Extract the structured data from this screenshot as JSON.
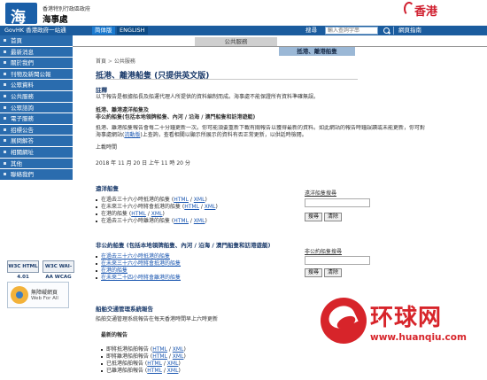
{
  "header": {
    "dept_small": "香港特別行政區政府",
    "dept_big": "海事處",
    "brand": "香港",
    "logo_glyph": "海"
  },
  "navbar": {
    "gov_link": "GovHK 香港政府一站通",
    "lang_1": "简体版",
    "lang_2": "ENGLISH",
    "search_label": "搜尋",
    "search_placeholder": "輸入查詢字串",
    "map_link": "網頁指南"
  },
  "sidebar": {
    "items": [
      "首頁",
      "最新消息",
      "關於我們",
      "刊物及新聞公報",
      "公眾資料",
      "公共服務",
      "公眾諮詢",
      "電子服務",
      "招標公告",
      "展問解答",
      "相關網址",
      "其他",
      "聯絡我們"
    ],
    "badge_w3c": "W3C HTML 4.01",
    "badge_wai": "W3C WAI-AA WCAG 2.0",
    "badge_web_1": "無障礙網頁",
    "badge_web_2": "Web For All"
  },
  "tabs": {
    "public": "公共服務",
    "sub": "抵港、離港船隻"
  },
  "breadcrumb": {
    "home": "首頁",
    "sep": " > ",
    "current": "公共服務"
  },
  "page": {
    "title": "抵港、離港船隻 (只提供英文版)",
    "notes_heading": "註釋",
    "notes_line": "以下報告是根據船長及船運代理人所提供的資料編制而成。海事處不能保證所有資料準確無誤。",
    "sub_heading_1": "抵港、離港遠洋船隻及",
    "sub_heading_2": "非公約船隻(包括本地領牌船隻、內河 / 沿海 / 澳門船隻和訪港遊艇)",
    "desc_1": "抵港、離港船隻報告會每二十分鐘更新一次。你可能須要重新下載有關報告以獲得最新的資料。如此網站的報告時鐘誤讀或未能更新，你可對",
    "desc_2_pre": "海事處網站",
    "desc_2_link": "流動版",
    "desc_2_post": "上查詢，查看相關以顯示所展示的資料有否正常更新，以供話時檢閱。",
    "update_label": "上載時間",
    "update_time": "2018 年 11 月 20 日 上午 11 時 20 分"
  },
  "ocean": {
    "heading": "遠洋船隻",
    "items": [
      {
        "text": "在過去三十六小時抵港的船隻 (",
        "html": "HTML",
        "slash": " / ",
        "xml": "XML",
        "end": ")"
      },
      {
        "text": "在未來三十六小時將會抵港的船隻 (",
        "html": "HTML",
        "slash": " / ",
        "xml": "XML",
        "end": ")"
      },
      {
        "text": "在港的船隻 (",
        "html": "HTML",
        "slash": " / ",
        "xml": "XML",
        "end": ")"
      },
      {
        "text": "在過去三十六小時離港的船隻 (",
        "html": "HTML",
        "slash": " / ",
        "xml": "XML",
        "end": ")"
      }
    ],
    "search_label": "遠洋船隻搜尋",
    "search_btn": "搜尋",
    "clear_btn": "清除"
  },
  "nonconv": {
    "heading": "非公約船隻 (包括本地領牌船隻、內河 / 沿海 / 澳門船隻和訪港遊艇)",
    "items": [
      "在過去三十六小時抵港的船隻",
      "在未來三十六小時將會抵港的船隻",
      "在港的船隻",
      "在未來二十四小時將會離港的船隻"
    ],
    "search_label": "非公約船隻搜尋",
    "search_btn": "搜尋",
    "clear_btn": "清除"
  },
  "traffic": {
    "heading": "船舶交通管理系統報告",
    "desc": "船舶交通管理系統報告在每天香港時間早上六時更新",
    "latest": "最新的報告",
    "items": [
      {
        "text": "即將抵港船舶報告 (",
        "html": "HTML",
        "slash": " / ",
        "xml": "XML",
        "end": ")"
      },
      {
        "text": "即將離港船舶報告 (",
        "html": "HTML",
        "slash": " / ",
        "xml": "XML",
        "end": ")"
      },
      {
        "text": "已抵港船舶報告 (",
        "html": "HTML",
        "slash": " / ",
        "xml": "XML",
        "end": ")"
      },
      {
        "text": "已離港船舶報告 (",
        "html": "HTML",
        "slash": " / ",
        "xml": "XML",
        "end": ")"
      }
    ]
  },
  "watermark": {
    "cn": "环球网",
    "url": "www.huanqiu.com"
  },
  "colors": {
    "nav_blue": "#1b5c9e",
    "menu_blue": "#2a6cae",
    "title_blue": "#1a3a6a",
    "link_blue": "#1a56b0",
    "brand_red": "#d7242a"
  }
}
